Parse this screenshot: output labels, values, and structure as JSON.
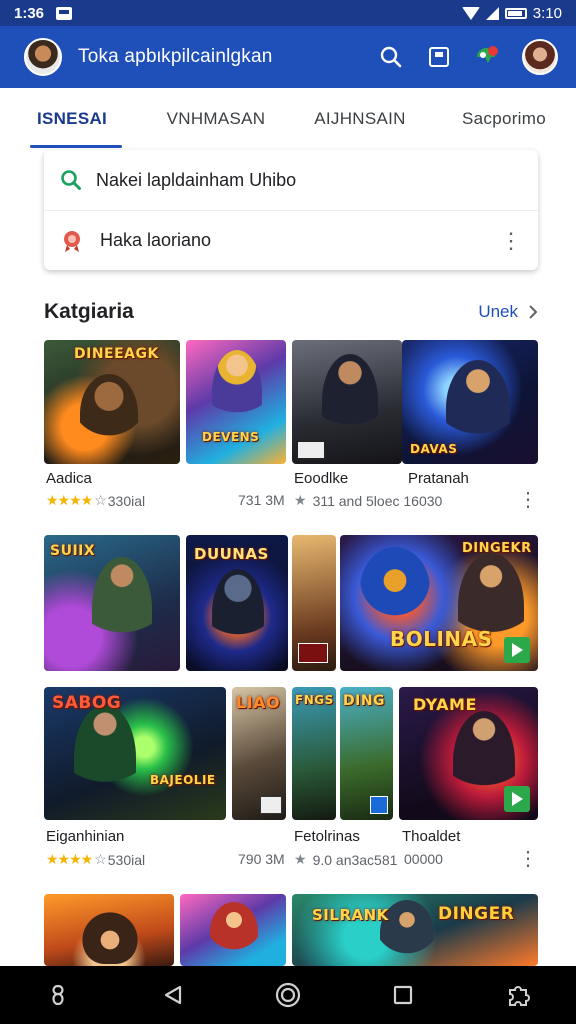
{
  "status_bar": {
    "time": "1:36",
    "clock_right": "3:10"
  },
  "app_bar": {
    "title": "Toka apbιkpilcainlgkan"
  },
  "tabs": [
    {
      "label": "ISNESAI",
      "active": true
    },
    {
      "label": "VNHMASAN",
      "active": false
    },
    {
      "label": "AIJHNSAIN",
      "active": false
    },
    {
      "label": "Sacporimo",
      "active": false
    }
  ],
  "search": {
    "query_suggestion": "Nakei lapldainham Uhibo",
    "recent_suggestion": "Haka laoriano"
  },
  "section": {
    "title": "Katgiaria",
    "see_all": "Unek"
  },
  "grid": {
    "row1": {
      "captions": [
        "Aadica",
        "Eoodlke",
        "Pratanah"
      ],
      "ratings": {
        "a": "★★★★",
        "a_rest": "☆",
        "a_count": "330ial",
        "b_size": "731 3M",
        "c_star": "★",
        "c_count": "311 and 5loec 16030"
      }
    },
    "row3": {
      "captions": [
        "Eiganhinian",
        "Fetolrinas",
        "Thoaldet"
      ],
      "ratings": {
        "a": "★★★★",
        "a_rest": "☆",
        "a_count": "530ial",
        "b_size": "790 3M",
        "c_star": "★",
        "c_count": "9.0 an3ac581",
        "d_count": "00000"
      }
    },
    "tile_text": {
      "t1": "DINEEAGK",
      "t2": "DEVENS",
      "t4": "DAVAS",
      "t5": "SUIIX",
      "t6": "DUUNAS",
      "t8": "DINGEKR",
      "t8b": "BOLINAS",
      "t9": "SABOG",
      "t9b": "BAJEOLIE",
      "t10": "LIAO",
      "t11": "FNGS",
      "t12": "DING",
      "t13": "DYAME",
      "t15": "DINGER",
      "t16": "SILRANK"
    }
  },
  "colors": {
    "primary": "#1f4fb8",
    "status": "#1a3a8c",
    "star": "#f4b400"
  }
}
